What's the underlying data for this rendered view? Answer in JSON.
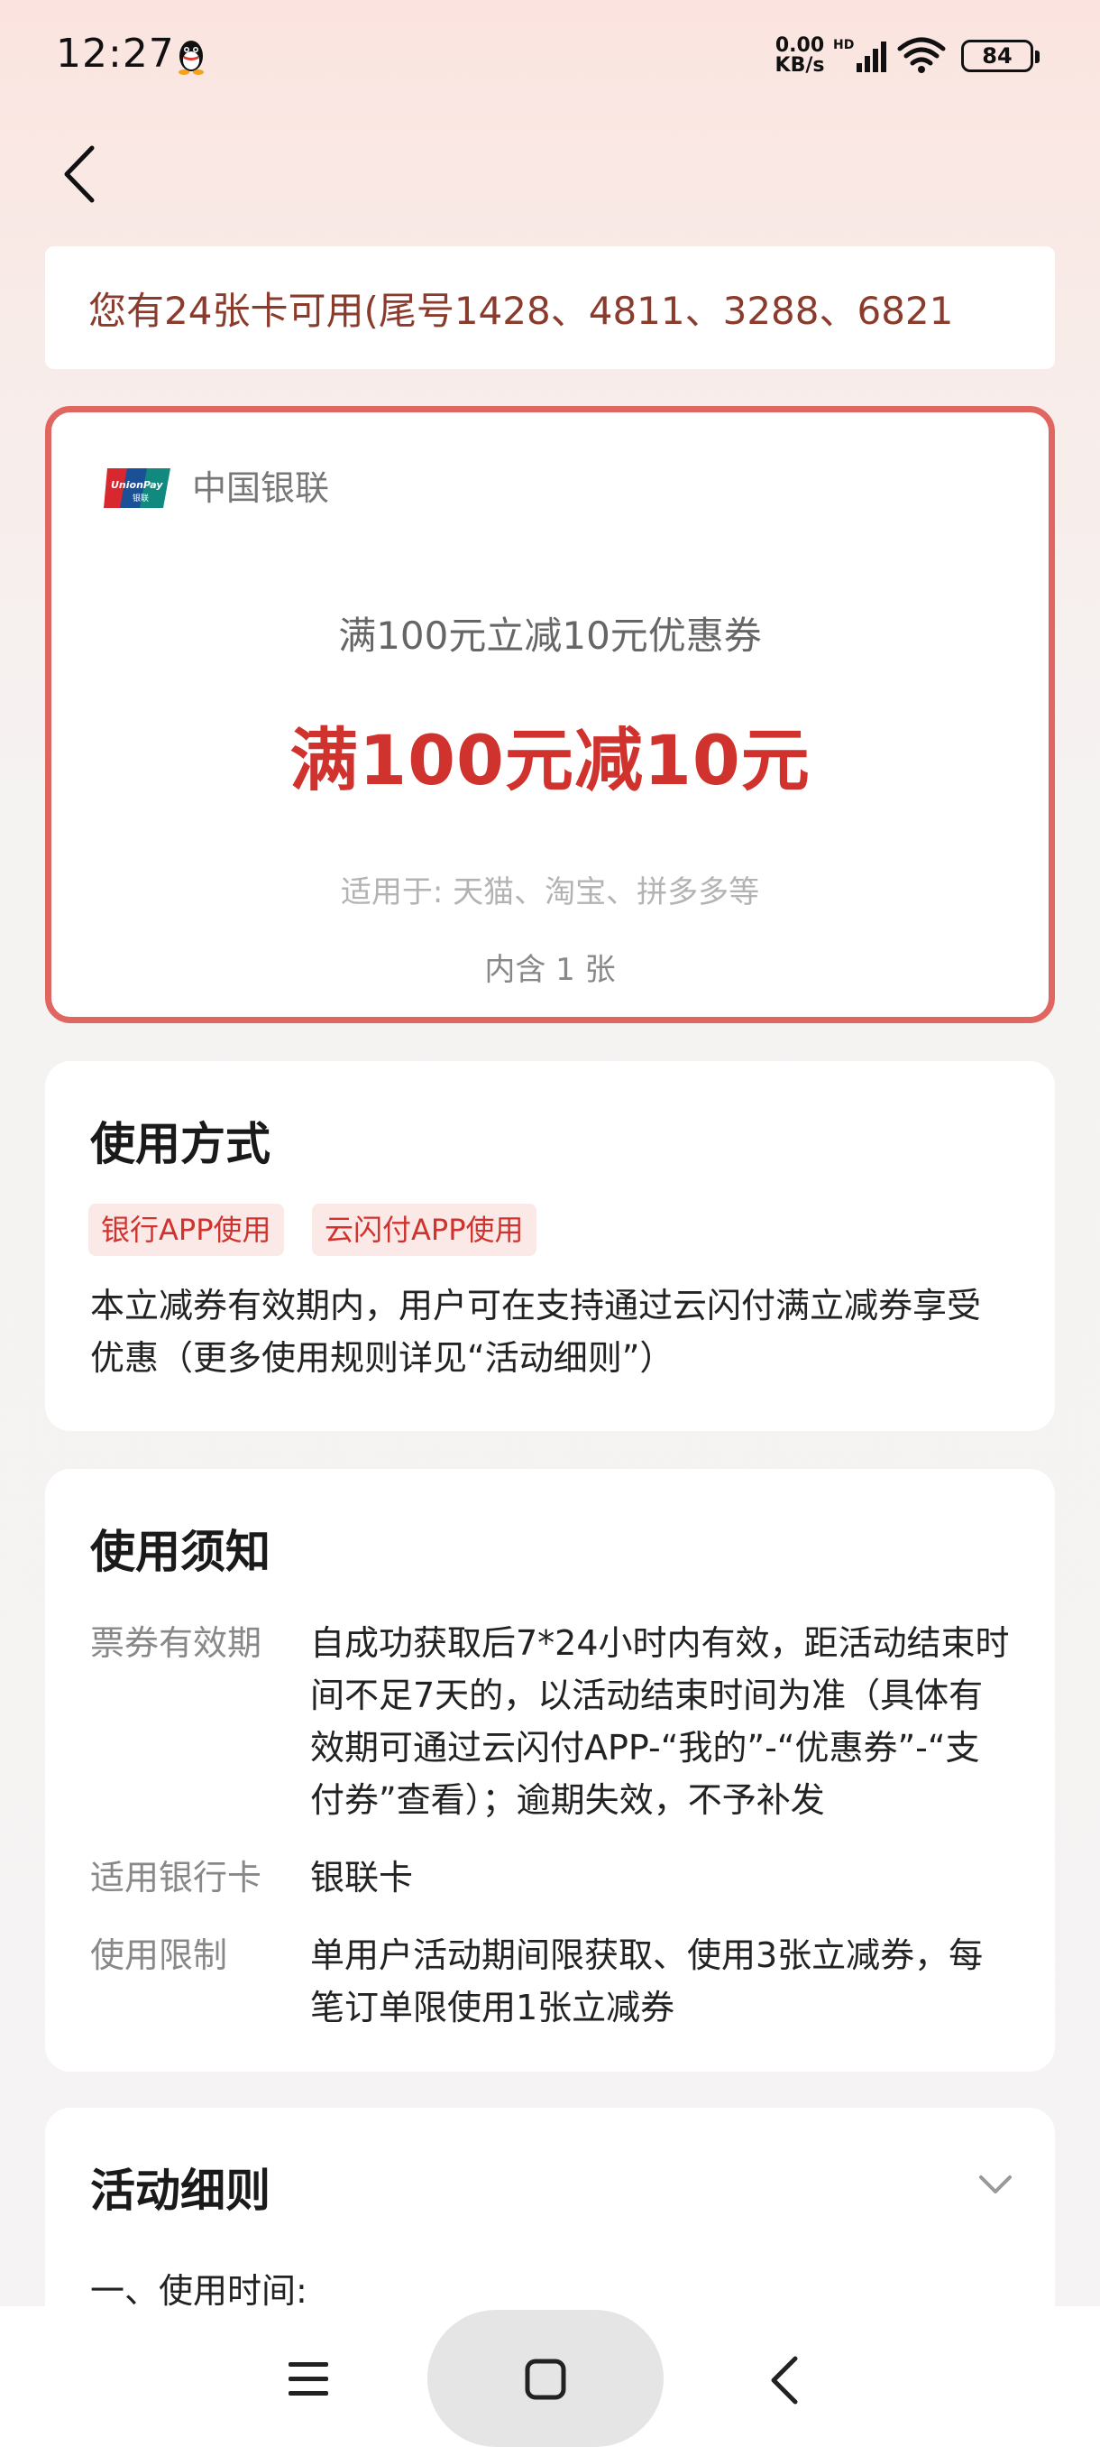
{
  "status_bar": {
    "time": "12:27",
    "net_speed_value": "0.00",
    "net_speed_unit": "KB/s",
    "signal_label": "HD",
    "battery": "84",
    "icons": [
      "qq-icon",
      "signal-icon",
      "wifi-icon",
      "battery-icon"
    ]
  },
  "header": {
    "back_icon": "back-arrow-icon"
  },
  "cards_banner": {
    "text": "您有24张卡可用(尾号1428、4811、3288、6821"
  },
  "coupon": {
    "brand": "中国银联",
    "brand_logo_text": "UnionPay 银联",
    "subtitle": "满100元立减10元优惠券",
    "amount": "满100元减10元",
    "applicable": "适用于: 天猫、淘宝、拼多多等",
    "count": "内含 1 张",
    "accent_color": "#d0322d",
    "border_color": "#e06661"
  },
  "usage": {
    "title": "使用方式",
    "tags": [
      "银行APP使用",
      "云闪付APP使用"
    ],
    "description": "本立减券有效期内，用户可在支持通过云闪付满立减券享受优惠（更多使用规则详见“活动细则”）"
  },
  "notes": {
    "title": "使用须知",
    "items": [
      {
        "label": "票券有效期",
        "value": "自成功获取后7*24小时内有效，距活动结束时间不足7天的，以活动结束时间为准（具体有效期可通过云闪付APP-“我的”-“优惠券”-“支付券”查看）；逾期失效，不予补发"
      },
      {
        "label": "适用银行卡",
        "value": "银联卡"
      },
      {
        "label": "使用限制",
        "value": "单用户活动期间限获取、使用3张立减券，每笔订单限使用1张立减券"
      }
    ]
  },
  "rules": {
    "title": "活动细则",
    "first_item": "一、使用时间:",
    "toggle_icon": "chevron-down-icon"
  },
  "nav_bar": {
    "icons": [
      "menu-icon",
      "home-square-icon",
      "back-triangle-icon"
    ]
  }
}
